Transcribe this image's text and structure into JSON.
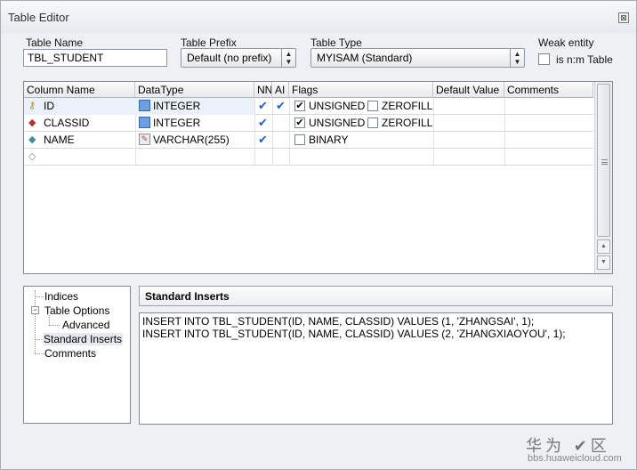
{
  "window": {
    "title": "Table Editor"
  },
  "fields": {
    "table_name_label": "Table Name",
    "table_name_value": "TBL_STUDENT",
    "table_prefix_label": "Table Prefix",
    "table_prefix_value": "Default (no prefix)",
    "table_type_label": "Table Type",
    "table_type_value": "MYISAM  (Standard)",
    "weak_entity_label": "Weak entity",
    "nm_table_label": "is n:m Table"
  },
  "grid": {
    "headers": [
      "Column Name",
      "DataType",
      "NN",
      "AI",
      "Flags",
      "Default Value",
      "Comments"
    ],
    "rows": [
      {
        "name": "ID",
        "type": "INTEGER",
        "nn": "✔",
        "ai": "✔",
        "flag1": "UNSIGNED",
        "flag1_checked": "✔",
        "flag2": "ZEROFILL",
        "icon": "key-icon"
      },
      {
        "name": "CLASSID",
        "type": "INTEGER",
        "nn": "✔",
        "ai": "",
        "flag1": "UNSIGNED",
        "flag1_checked": "✔",
        "flag2": "ZEROFILL",
        "icon": "foreign-key-diamond-icon"
      },
      {
        "name": "NAME",
        "type": "VARCHAR(255)",
        "nn": "✔",
        "ai": "",
        "flag1": "BINARY",
        "flag1_checked": "",
        "flag2": "",
        "icon": "column-diamond-icon"
      }
    ]
  },
  "tree": {
    "items": [
      "Indices",
      "Table Options",
      "Advanced",
      "Standard Inserts",
      "Comments"
    ],
    "expander": "−"
  },
  "panel": {
    "title": "Standard Inserts",
    "sql_lines": [
      "INSERT INTO TBL_STUDENT(ID, NAME, CLASSID) VALUES (1, 'ZHANGSAI', 1);",
      "INSERT INTO TBL_STUDENT(ID, NAME, CLASSID) VALUES (2, 'ZHANGXIAOYOU', 1);"
    ]
  },
  "watermark": {
    "text": "华为 ✔区",
    "url": "bbs.huaweicloud.com"
  },
  "colors": {
    "accent": "#2b5fb0",
    "selection": "#eaf1fb"
  }
}
